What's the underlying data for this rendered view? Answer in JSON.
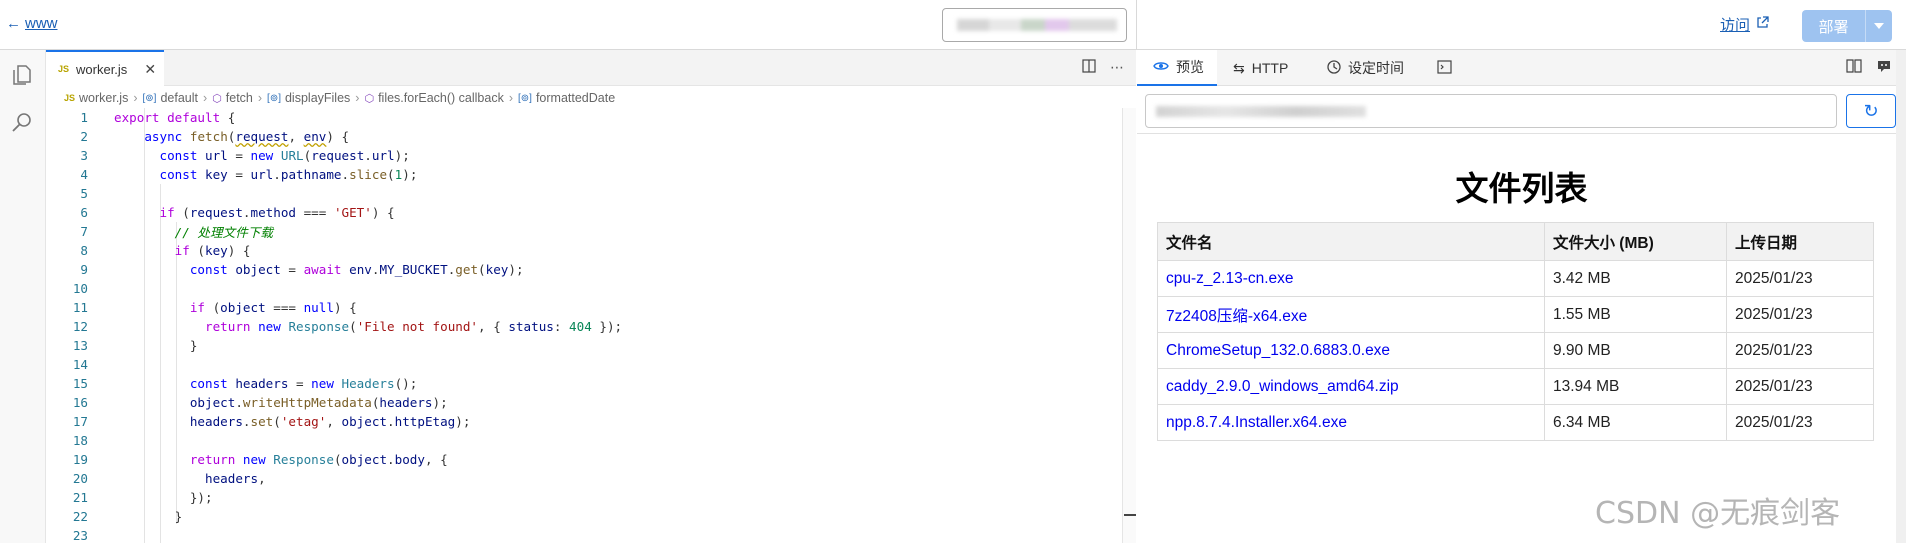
{
  "topbar": {
    "back_label": "www",
    "visit_label": "访问",
    "deploy_label": "部署"
  },
  "editor": {
    "tab_badge": "JS",
    "tab_label": "worker.js",
    "breadcrumb": [
      "worker.js",
      "default",
      "fetch",
      "displayFiles",
      "files.forEach() callback",
      "formattedDate"
    ],
    "line_numbers": [
      "1",
      "2",
      "3",
      "4",
      "5",
      "6",
      "7",
      "8",
      "9",
      "10",
      "11",
      "12",
      "13",
      "14",
      "15",
      "16",
      "17",
      "18",
      "19",
      "20",
      "21",
      "22",
      "23"
    ]
  },
  "preview": {
    "tabs": [
      "预览",
      "HTTP",
      "设定时间"
    ],
    "page_title": "文件列表",
    "table_headers": [
      "文件名",
      "文件大小 (MB)",
      "上传日期"
    ],
    "files": [
      {
        "name": "cpu-z_2.13-cn.exe",
        "size": "3.42 MB",
        "date": "2025/01/23"
      },
      {
        "name": "7z2408压缩-x64.exe",
        "size": "1.55 MB",
        "date": "2025/01/23"
      },
      {
        "name": "ChromeSetup_132.0.6883.0.exe",
        "size": "9.90 MB",
        "date": "2025/01/23"
      },
      {
        "name": "caddy_2.9.0_windows_amd64.zip",
        "size": "13.94 MB",
        "date": "2025/01/23"
      },
      {
        "name": "npp.8.7.4.Installer.x64.exe",
        "size": "6.34 MB",
        "date": "2025/01/23"
      }
    ]
  },
  "watermark": "CSDN @无痕剑客",
  "colors": {
    "accent": "#1a73e8",
    "link": "#1a5fb4",
    "deploy": "#9ec3f0"
  }
}
